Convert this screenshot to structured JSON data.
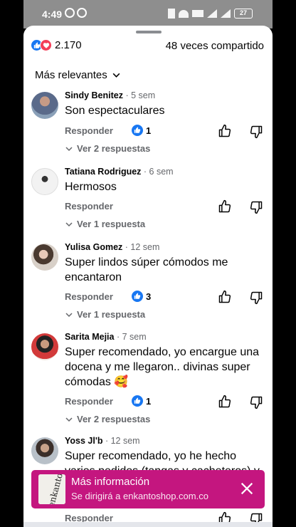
{
  "status": {
    "time": "4:49",
    "battery": "27"
  },
  "header": {
    "reaction_count": "2.170",
    "shares": "48 veces compartido"
  },
  "sort": {
    "label": "Más relevantes"
  },
  "comments": [
    {
      "author": "Sindy Benitez",
      "time": "5 sem",
      "text": "Son espectaculares",
      "reply": "Responder",
      "likes": "1",
      "replies": "Ver 2 respuestas"
    },
    {
      "author": "Tatiana Rodriguez",
      "time": "6 sem",
      "text": "Hermosos",
      "reply": "Responder",
      "likes": "",
      "replies": "Ver 1 respuesta"
    },
    {
      "author": "Yulisa Gomez",
      "time": "12 sem",
      "text": "Super lindos súper cómodos me encantaron",
      "reply": "Responder",
      "likes": "3",
      "replies": "Ver 1 respuesta"
    },
    {
      "author": "Sarita Mejia",
      "time": "7 sem",
      "text": "Super recomendado,  yo encargue una docena y me llegaron.. divinas super cómodas 🥰",
      "reply": "Responder",
      "likes": "1",
      "replies": "Ver 2 respuestas"
    },
    {
      "author": "Yoss Jl'b",
      "time": "12 sem",
      "text": "Super recomendado, yo he hecho varios pedidos (tangas y cacheteros) y",
      "reply": "Responder",
      "likes": "",
      "replies": ""
    }
  ],
  "banner": {
    "title": "Más información",
    "subtitle": "Se dirigirá a enkantoshop.com.co",
    "thumb_text": "enkanto"
  },
  "colors": {
    "accent_like": "#1877f2",
    "love": "#f33e58",
    "banner": "#c4167f"
  },
  "icons": [
    "like-icon",
    "love-icon",
    "chevron-down-icon",
    "thumbs-up-icon",
    "thumbs-down-icon",
    "close-icon"
  ]
}
